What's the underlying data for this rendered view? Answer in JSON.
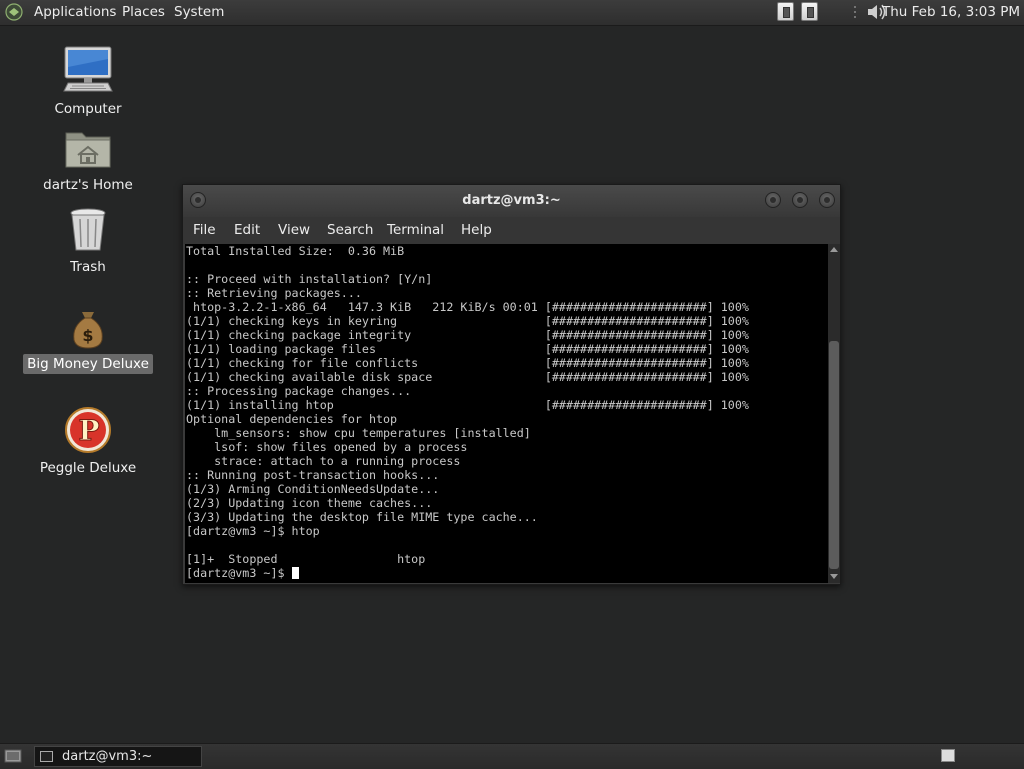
{
  "top_panel": {
    "menus": [
      "Applications",
      "Places",
      "System"
    ],
    "clock": "Thu Feb 16,  3:03 PM"
  },
  "desktop_icons": [
    {
      "label": "Computer",
      "icon": "computer-icon"
    },
    {
      "label": "dartz's Home",
      "icon": "home-folder-icon"
    },
    {
      "label": "Trash",
      "icon": "trash-icon"
    },
    {
      "label": "Big Money Deluxe",
      "icon": "money-bag-icon",
      "selected": true
    },
    {
      "label": "Peggle Deluxe",
      "icon": "peggle-icon"
    }
  ],
  "terminal": {
    "title": "dartz@vm3:~",
    "menu": [
      "File",
      "Edit",
      "View",
      "Search",
      "Terminal",
      "Help"
    ],
    "lines": [
      "Total Installed Size:  0.36 MiB",
      "",
      ":: Proceed with installation? [Y/n]",
      ":: Retrieving packages...",
      " htop-3.2.2-1-x86_64   147.3 KiB   212 KiB/s 00:01 [######################] 100%",
      "(1/1) checking keys in keyring                     [######################] 100%",
      "(1/1) checking package integrity                   [######################] 100%",
      "(1/1) loading package files                        [######################] 100%",
      "(1/1) checking for file conflicts                  [######################] 100%",
      "(1/1) checking available disk space                [######################] 100%",
      ":: Processing package changes...",
      "(1/1) installing htop                              [######################] 100%",
      "Optional dependencies for htop",
      "    lm_sensors: show cpu temperatures [installed]",
      "    lsof: show files opened by a process",
      "    strace: attach to a running process",
      ":: Running post-transaction hooks...",
      "(1/3) Arming ConditionNeedsUpdate...",
      "(2/3) Updating icon theme caches...",
      "(3/3) Updating the desktop file MIME type cache...",
      "[dartz@vm3 ~]$ htop",
      "",
      "[1]+  Stopped                 htop"
    ],
    "prompt": "[dartz@vm3 ~]$ "
  },
  "taskbar": {
    "task_label": "dartz@vm3:~"
  }
}
